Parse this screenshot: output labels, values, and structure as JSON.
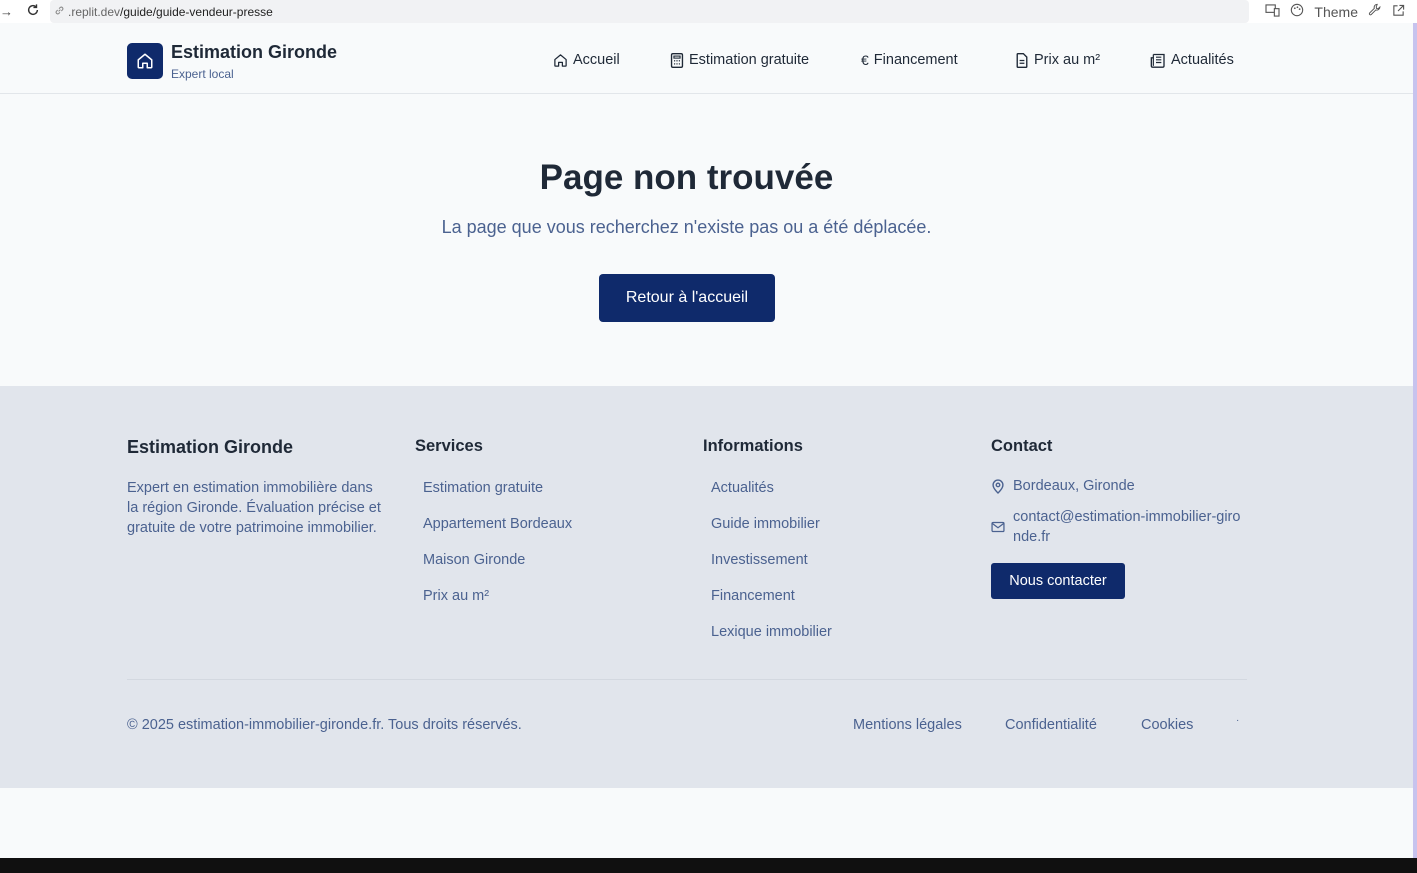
{
  "browser": {
    "url_host": ".replit.dev",
    "url_path": "/guide/guide-vendeur-presse",
    "theme_label": "Theme"
  },
  "header": {
    "brand_title": "Estimation Gironde",
    "brand_subtitle": "Expert local",
    "nav": [
      {
        "label": "Accueil",
        "icon": "home-icon"
      },
      {
        "label": "Estimation gratuite",
        "icon": "calculator-icon"
      },
      {
        "label": "Financement",
        "icon": "euro-icon"
      },
      {
        "label": "Prix au m²",
        "icon": "document-icon"
      },
      {
        "label": "Actualités",
        "icon": "newspaper-icon"
      }
    ]
  },
  "main": {
    "title": "Page non trouvée",
    "description": "La page que vous recherchez n'existe pas ou a été déplacée.",
    "home_button": "Retour à l'accueil"
  },
  "footer": {
    "brand_title": "Estimation Gironde",
    "brand_description": "Expert en estimation immobilière dans la région Gironde. Évaluation précise et gratuite de votre patrimoine immobilier.",
    "services": {
      "heading": "Services",
      "links": [
        "Estimation gratuite",
        "Appartement Bordeaux",
        "Maison Gironde",
        "Prix au m²"
      ]
    },
    "informations": {
      "heading": "Informations",
      "links": [
        "Actualités",
        "Guide immobilier",
        "Investissement",
        "Financement",
        "Lexique immobilier"
      ]
    },
    "contact": {
      "heading": "Contact",
      "location": "Bordeaux, Gironde",
      "email": "contact@estimation-immobilier-gironde.fr",
      "button": "Nous contacter"
    },
    "copyright": "© 2025 estimation-immobilier-gironde.fr. Tous droits réservés.",
    "legal_links": [
      "Mentions légales",
      "Confidentialité",
      "Cookies"
    ],
    "separator": "·"
  },
  "colors": {
    "primary": "#0f2a6b",
    "muted_text": "#4b6290",
    "footer_bg": "#e1e5ec",
    "page_bg": "#f8fafb"
  }
}
